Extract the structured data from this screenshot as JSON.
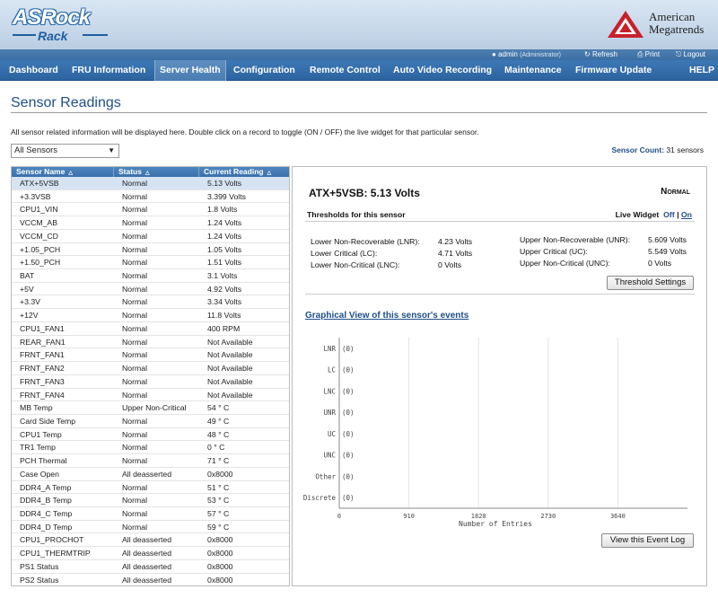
{
  "brand": {
    "logo_top": "ASRock",
    "logo_bottom": "Rack",
    "vendor_line1": "American",
    "vendor_line2": "Megatrends"
  },
  "utility": {
    "user": "admin",
    "role": "(Administrator)",
    "refresh": "Refresh",
    "print": "Print",
    "logout": "Logout"
  },
  "nav": [
    "Dashboard",
    "FRU Information",
    "Server Health",
    "Configuration",
    "Remote Control",
    "Auto Video Recording",
    "Maintenance",
    "Firmware Update",
    "HELP"
  ],
  "nav_active": "Server Health",
  "page": {
    "title": "Sensor Readings",
    "description": "All sensor related information will be displayed here. Double click on a record to toggle (ON / OFF) the live widget for that particular sensor.",
    "filter": "All Sensors",
    "count_label": "Sensor Count:",
    "count_value": "31 sensors"
  },
  "table": {
    "headers": [
      "Sensor Name",
      "Status",
      "Current Reading"
    ],
    "rows": [
      [
        "ATX+5VSB",
        "Normal",
        "5.13 Volts"
      ],
      [
        "+3.3VSB",
        "Normal",
        "3.399 Volts"
      ],
      [
        "CPU1_VIN",
        "Normal",
        "1.8 Volts"
      ],
      [
        "VCCM_AB",
        "Normal",
        "1.24 Volts"
      ],
      [
        "VCCM_CD",
        "Normal",
        "1.24 Volts"
      ],
      [
        "+1.05_PCH",
        "Normal",
        "1.05 Volts"
      ],
      [
        "+1.50_PCH",
        "Normal",
        "1.51 Volts"
      ],
      [
        "BAT",
        "Normal",
        "3.1 Volts"
      ],
      [
        "+5V",
        "Normal",
        "4.92 Volts"
      ],
      [
        "+3.3V",
        "Normal",
        "3.34 Volts"
      ],
      [
        "+12V",
        "Normal",
        "11.8 Volts"
      ],
      [
        "CPU1_FAN1",
        "Normal",
        "400 RPM"
      ],
      [
        "REAR_FAN1",
        "Normal",
        "Not Available"
      ],
      [
        "FRNT_FAN1",
        "Normal",
        "Not Available"
      ],
      [
        "FRNT_FAN2",
        "Normal",
        "Not Available"
      ],
      [
        "FRNT_FAN3",
        "Normal",
        "Not Available"
      ],
      [
        "FRNT_FAN4",
        "Normal",
        "Not Available"
      ],
      [
        "MB Temp",
        "Upper Non-Critical",
        "54 ° C"
      ],
      [
        "Card Side Temp",
        "Normal",
        "49 ° C"
      ],
      [
        "CPU1 Temp",
        "Normal",
        "48 ° C"
      ],
      [
        "TR1 Temp",
        "Normal",
        "0 ° C"
      ],
      [
        "PCH Thermal",
        "Normal",
        "71 ° C"
      ],
      [
        "Case Open",
        "All deasserted",
        "0x8000"
      ],
      [
        "DDR4_A Temp",
        "Normal",
        "51 ° C"
      ],
      [
        "DDR4_B Temp",
        "Normal",
        "53 ° C"
      ],
      [
        "DDR4_C Temp",
        "Normal",
        "57 ° C"
      ],
      [
        "DDR4_D Temp",
        "Normal",
        "59 ° C"
      ],
      [
        "CPU1_PROCHOT",
        "All deasserted",
        "0x8000"
      ],
      [
        "CPU1_THERMTRIP",
        "All deasserted",
        "0x8000"
      ],
      [
        "PS1 Status",
        "All deasserted",
        "0x8000"
      ],
      [
        "PS2 Status",
        "All deasserted",
        "0x8000"
      ]
    ],
    "selected_row": 0
  },
  "detail": {
    "title": "ATX+5VSB: 5.13 Volts",
    "state": "Normal",
    "thresholds_label": "Thresholds for this sensor",
    "live_widget_label": "Live Widget",
    "live_off": "Off",
    "live_sep": "|",
    "live_on": "On",
    "lower": [
      {
        "label": "Lower Non-Recoverable (LNR):",
        "value": "4.23 Volts"
      },
      {
        "label": "Lower Critical (LC):",
        "value": "4.71 Volts"
      },
      {
        "label": "Lower Non-Critical (LNC):",
        "value": "0 Volts"
      }
    ],
    "upper": [
      {
        "label": "Upper Non-Recoverable (UNR):",
        "value": "5.609 Volts"
      },
      {
        "label": "Upper Critical (UC):",
        "value": "5.549 Volts"
      },
      {
        "label": "Upper Non-Critical (UNC):",
        "value": "0 Volts"
      }
    ],
    "threshold_button": "Threshold Settings",
    "graph_title": "Graphical View of this sensor's events",
    "event_log_button": "View this Event Log"
  },
  "chart_data": {
    "type": "bar",
    "orientation": "horizontal",
    "categories": [
      "LNR",
      "LC",
      "LNC",
      "UNR",
      "UC",
      "UNC",
      "Other",
      "Discrete"
    ],
    "values": [
      0,
      0,
      0,
      0,
      0,
      0,
      0,
      0
    ],
    "value_labels": [
      "(0)",
      "(0)",
      "(0)",
      "(0)",
      "(0)",
      "(0)",
      "(0)",
      "(0)"
    ],
    "xticks": [
      "0",
      "910",
      "1820",
      "2730",
      "3640"
    ],
    "xlabel": "Number of Entries",
    "xlim": [
      0,
      4550
    ],
    "grid": true
  }
}
